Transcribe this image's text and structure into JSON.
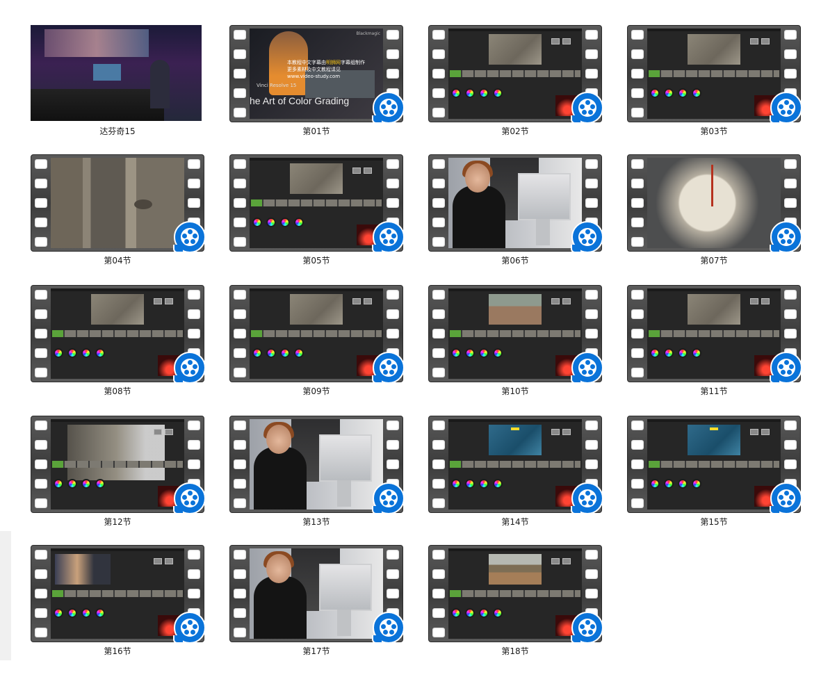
{
  "items": [
    {
      "label": "达芬奇15",
      "style": "studio",
      "film": false
    },
    {
      "label": "第01节",
      "style": "title",
      "film": true
    },
    {
      "label": "第02节",
      "style": "resolve",
      "film": true
    },
    {
      "label": "第03节",
      "style": "resolve",
      "film": true
    },
    {
      "label": "第04节",
      "style": "rhino",
      "film": true
    },
    {
      "label": "第05节",
      "style": "resolve",
      "film": true
    },
    {
      "label": "第06节",
      "style": "person",
      "film": true
    },
    {
      "label": "第07节",
      "style": "scale",
      "film": true
    },
    {
      "label": "第08节",
      "style": "resolve",
      "film": true
    },
    {
      "label": "第09节",
      "style": "resolve",
      "film": true
    },
    {
      "label": "第10节",
      "style": "resolve field",
      "film": true
    },
    {
      "label": "第11节",
      "style": "resolve",
      "film": true
    },
    {
      "label": "第12节",
      "style": "resolve overlay",
      "film": true
    },
    {
      "label": "第13节",
      "style": "person",
      "film": true
    },
    {
      "label": "第14节",
      "style": "resolve ocean",
      "film": true
    },
    {
      "label": "第15节",
      "style": "resolve ocean",
      "film": true
    },
    {
      "label": "第16节",
      "style": "resolve man",
      "film": true
    },
    {
      "label": "第17节",
      "style": "person",
      "film": true
    },
    {
      "label": "第18节",
      "style": "resolve africa",
      "film": true
    }
  ],
  "title_frame": {
    "cn_line1_a": "本教程中文字幕由",
    "cn_line1_b": "明狮网",
    "cn_line1_c": "字幕组制作",
    "cn_line2": "更多素材及中文教程请见",
    "url": "www.video-study.com",
    "product": "Vinci Resolve 15",
    "headline": "he Art of Color Grading",
    "brand": "Blackmagic"
  },
  "icons": {
    "badge": "video-player-icon"
  }
}
